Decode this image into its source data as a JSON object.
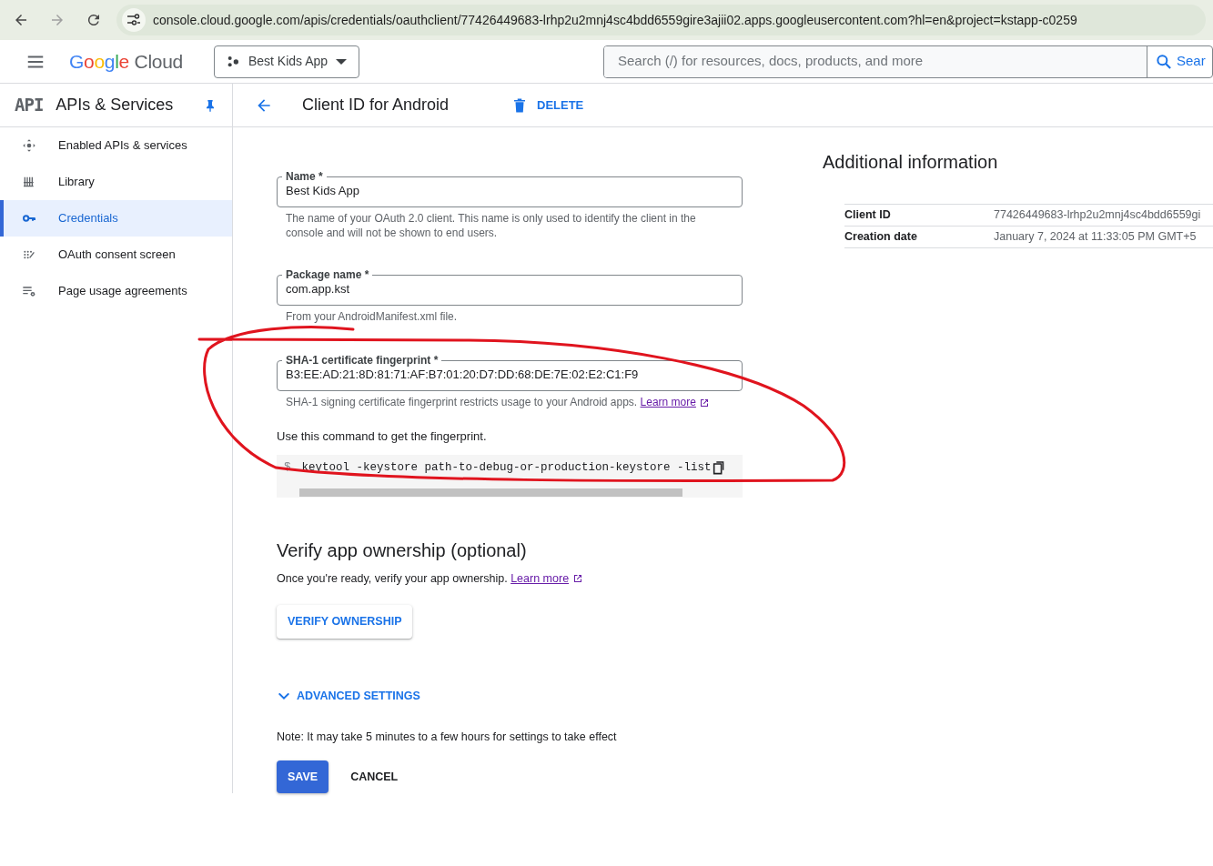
{
  "browser": {
    "url": "console.cloud.google.com/apis/credentials/oauthclient/77426449683-lrhp2u2mnj4sc4bdd6559gire3ajii02.apps.googleusercontent.com?hl=en&project=kstapp-c0259"
  },
  "header": {
    "logo": [
      "Google",
      "Cloud"
    ],
    "project": "Best Kids App",
    "search": {
      "placeholder": "Search (/) for resources, docs, products, and more",
      "button": "Sear"
    }
  },
  "sidebar": {
    "logo": "API",
    "title": "APIs & Services",
    "items": [
      {
        "label": "Enabled APIs & services",
        "selected": false
      },
      {
        "label": "Library",
        "selected": false
      },
      {
        "label": "Credentials",
        "selected": true
      },
      {
        "label": "OAuth consent screen",
        "selected": false
      },
      {
        "label": "Page usage agreements",
        "selected": false
      }
    ]
  },
  "page": {
    "title": "Client ID for Android",
    "delete": "DELETE"
  },
  "form": {
    "fields": [
      {
        "label": "Name *",
        "value": "Best Kids App",
        "help": "The name of your OAuth 2.0 client. This name is only used to identify the client in the console and will not be shown to end users."
      },
      {
        "label": "Package name *",
        "value": "com.app.kst",
        "help": "From your AndroidManifest.xml file."
      },
      {
        "label": "SHA-1 certificate fingerprint *",
        "value": "B3:EE:AD:21:8D:81:71:AF:B7:01:20:D7:DD:68:DE:7E:02:E2:C1:F9",
        "help": "SHA-1 signing certificate fingerprint restricts usage to your Android apps.",
        "link": "Learn more"
      }
    ],
    "command_intro": "Use this command to get the fingerprint.",
    "command": {
      "prompt": "$",
      "text": "keytool -keystore path-to-debug-or-production-keystore -list"
    }
  },
  "verify": {
    "heading": "Verify app ownership (optional)",
    "text": "Once you're ready, verify your app ownership.",
    "link": "Learn more",
    "button": "VERIFY OWNERSHIP"
  },
  "advanced": {
    "label": "ADVANCED SETTINGS",
    "expanded": false
  },
  "note": "Note: It may take 5 minutes to a few hours for settings to take effect",
  "actions": {
    "save": "SAVE",
    "cancel": "CANCEL"
  },
  "info": {
    "heading": "Additional information",
    "rows": [
      {
        "label": "Client ID",
        "value": "77426449683-lrhp2u2mnj4sc4bdd6559gi"
      },
      {
        "label": "Creation date",
        "value": "January 7, 2024 at 11:33:05 PM GMT+5"
      }
    ]
  }
}
